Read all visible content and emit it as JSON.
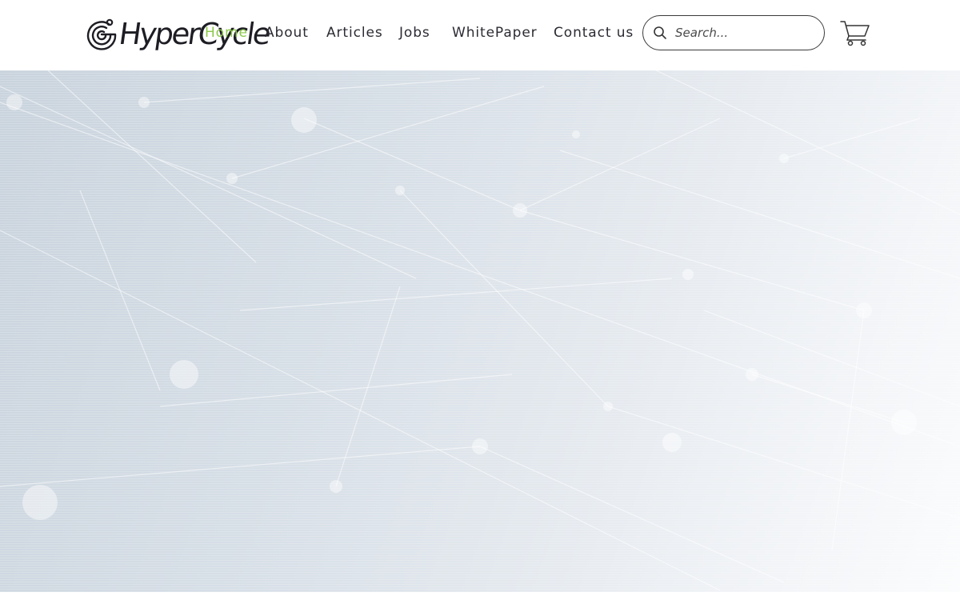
{
  "header": {
    "logo": {
      "text": "HyperCycle",
      "icon": "hypercycle-logo-icon"
    },
    "nav": [
      {
        "label": "Home",
        "active": true
      },
      {
        "label": "About",
        "active": false
      },
      {
        "label": "Articles",
        "active": false
      },
      {
        "label": "Jobs",
        "active": false
      },
      {
        "label": "WhitePaper",
        "active": false
      },
      {
        "label": "Contact us",
        "active": false
      }
    ],
    "search": {
      "placeholder": "Search...",
      "value": "",
      "icon": "search-icon"
    },
    "cart": {
      "icon": "cart-icon"
    }
  },
  "hero": {
    "background": "network-pattern"
  },
  "colors": {
    "active_nav": "#8cc84b",
    "text": "#2b2b33",
    "hero_bg": "#d6dee6"
  }
}
